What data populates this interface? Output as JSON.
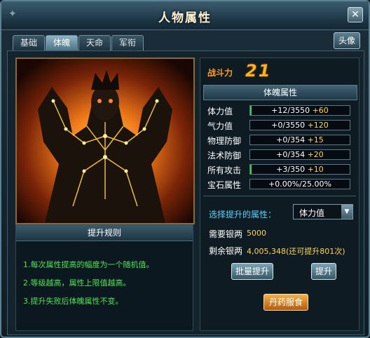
{
  "window": {
    "title": "人物属性",
    "close_label": "✕"
  },
  "tabs": [
    {
      "label": "基础",
      "active": false
    },
    {
      "label": "体魄",
      "active": true
    },
    {
      "label": "天命",
      "active": false
    },
    {
      "label": "军衔",
      "active": false
    }
  ],
  "avatar_button": "头像",
  "rules": {
    "title": "提升规则",
    "items": [
      "1.每次属性提高的幅度为一个随机值。",
      "2.等级越高，属性上限值越高。",
      "3.提升失败后体魄属性不变。"
    ]
  },
  "power": {
    "label": "战斗力",
    "value": "21"
  },
  "attributes": {
    "title": "体魄属性",
    "rows": [
      {
        "label": "体力值",
        "value": "+12/3550",
        "bonus": "+60",
        "fill": 0.003
      },
      {
        "label": "气力值",
        "value": "+0/3550",
        "bonus": "+120",
        "fill": 0
      },
      {
        "label": "物理防御",
        "value": "+0/354",
        "bonus": "+15",
        "fill": 0
      },
      {
        "label": "法术防御",
        "value": "+0/354",
        "bonus": "+20",
        "fill": 0
      },
      {
        "label": "所有攻击",
        "value": "+3/350",
        "bonus": "+10",
        "fill": 0.009
      },
      {
        "label": "宝石属性",
        "value": "+0.00%/25.00%",
        "bonus": "",
        "fill": 0
      }
    ]
  },
  "select": {
    "label": "选择提升的属性：",
    "value": "体力值"
  },
  "cost": {
    "need_label": "需要银两",
    "need_value": "5000",
    "remain_label": "剩余银两",
    "remain_value": "4,005,348(还可提升801次)"
  },
  "buttons": {
    "batch": "批量提升",
    "upgrade": "提升",
    "elixir": "丹药服食"
  },
  "colors": {
    "accent": "#ff9c2a",
    "rule_text": "#4ee35a",
    "select_label": "#59d4ff"
  }
}
